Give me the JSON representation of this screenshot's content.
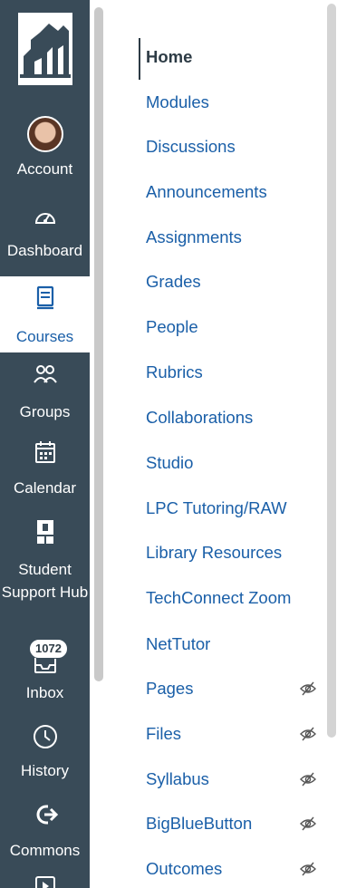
{
  "global_nav": {
    "items": [
      {
        "label": "Account",
        "icon": "avatar"
      },
      {
        "label": "Dashboard",
        "icon": "dashboard-icon"
      },
      {
        "label": "Courses",
        "icon": "courses-icon",
        "active": true
      },
      {
        "label": "Groups",
        "icon": "groups-icon"
      },
      {
        "label": "Calendar",
        "icon": "calendar-icon"
      },
      {
        "label": "Student Support Hub",
        "icon": "support-hub-icon"
      },
      {
        "label": "Inbox",
        "icon": "inbox-icon",
        "badge": "1072"
      },
      {
        "label": "History",
        "icon": "history-icon"
      },
      {
        "label": "Commons",
        "icon": "commons-icon"
      }
    ]
  },
  "course_nav": {
    "items": [
      {
        "label": "Home",
        "active": true
      },
      {
        "label": "Modules"
      },
      {
        "label": "Discussions"
      },
      {
        "label": "Announcements"
      },
      {
        "label": "Assignments"
      },
      {
        "label": "Grades"
      },
      {
        "label": "People"
      },
      {
        "label": "Rubrics"
      },
      {
        "label": "Collaborations"
      },
      {
        "label": "Studio"
      },
      {
        "label": "LPC Tutoring/RAW"
      },
      {
        "label": "Library Resources"
      },
      {
        "label": "TechConnect Zoom"
      },
      {
        "label": "NetTutor"
      },
      {
        "label": "Pages",
        "hidden": true
      },
      {
        "label": "Files",
        "hidden": true
      },
      {
        "label": "Syllabus",
        "hidden": true
      },
      {
        "label": "BigBlueButton",
        "hidden": true
      },
      {
        "label": "Outcomes",
        "hidden": true
      }
    ]
  },
  "colors": {
    "nav_bg": "#394b58",
    "link": "#1a5fa8",
    "text_dark": "#2d3b45"
  }
}
